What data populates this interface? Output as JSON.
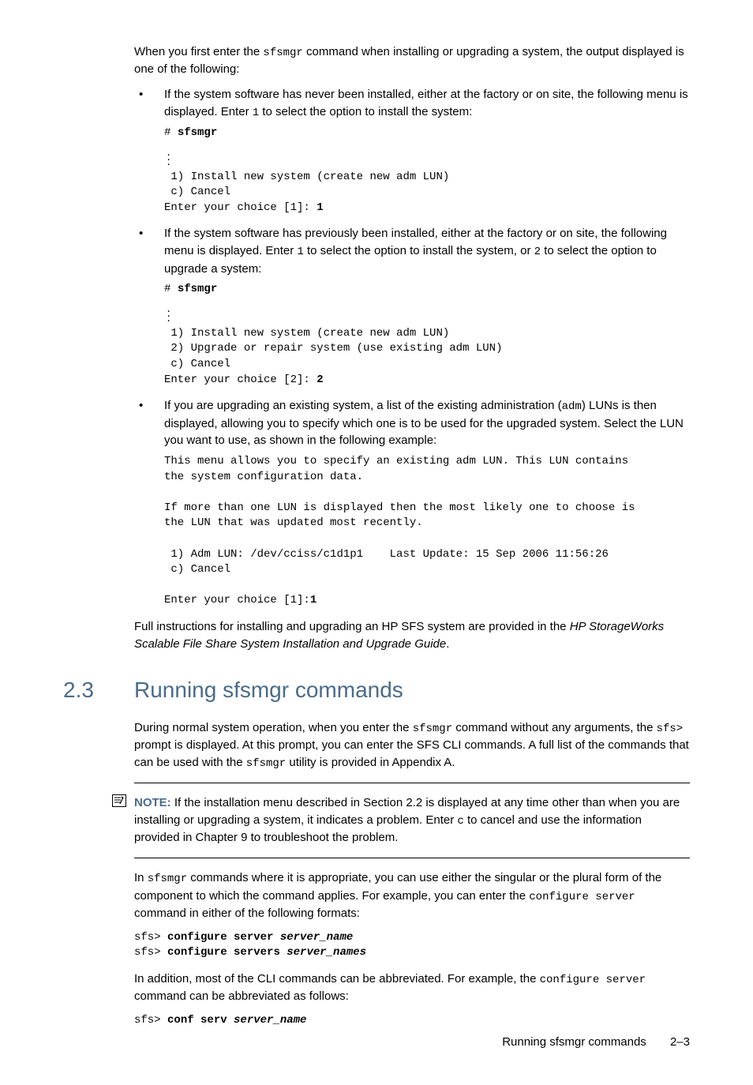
{
  "intro": {
    "p1_a": "When you first enter the ",
    "p1_cmd": "sfsmgr",
    "p1_b": " command when installing or upgrading a system, the output displayed is one of the following:"
  },
  "bullets": [
    {
      "text_a": "If the system software has never been installed, either at the factory or on site, the following menu is displayed. Enter ",
      "text_code": "1",
      "text_b": " to select the option to install the system:",
      "code_prompt": "# ",
      "code_cmd": "sfsmgr",
      "has_vdots": true,
      "code_body": " 1) Install new system (create new adm LUN)\n c) Cancel\nEnter your choice [1]: ",
      "code_input": "1"
    },
    {
      "text_a": "If the system software has previously been installed, either at the factory or on site, the following menu is displayed. Enter ",
      "text_code": "1",
      "text_b": " to select the option to install the system, or ",
      "text_code2": "2",
      "text_c": " to select the option to upgrade a system:",
      "code_prompt": "# ",
      "code_cmd": "sfsmgr",
      "has_vdots": true,
      "code_body": " 1) Install new system (create new adm LUN)\n 2) Upgrade or repair system (use existing adm LUN)\n c) Cancel\nEnter your choice [2]: ",
      "code_input": "2"
    },
    {
      "text_a": "If you are upgrading an existing system, a list of the existing administration (",
      "text_code": "adm",
      "text_b": ") LUNs is then displayed, allowing you to specify which one is to be used for the upgraded system. Select the LUN you want to use, as shown in the following example:",
      "code_body": "This menu allows you to specify an existing adm LUN. This LUN contains\nthe system configuration data.\n\nIf more than one LUN is displayed then the most likely one to choose is\nthe LUN that was updated most recently.\n\n 1) Adm LUN: /dev/cciss/c1d1p1    Last Update: 15 Sep 2006 11:56:26\n c) Cancel\n\nEnter your choice [1]:",
      "code_input": "1"
    }
  ],
  "post_bullets": {
    "a": "Full instructions for installing and upgrading an HP SFS system are provided in the ",
    "i": "HP StorageWorks Scalable File Share System Installation and Upgrade Guide",
    "b": "."
  },
  "section": {
    "num": "2.3",
    "title": "Running sfsmgr commands"
  },
  "running": {
    "p1_a": "During normal system operation, when you enter the ",
    "p1_c1": "sfsmgr",
    "p1_b": " command without any arguments, the ",
    "p1_c2": "sfs>",
    "p1_c": " prompt is displayed. At this prompt, you can enter the SFS CLI commands. A full list of the commands that can be used with the ",
    "p1_c3": "sfsmgr",
    "p1_d": " utility is provided in Appendix A."
  },
  "note": {
    "label": "NOTE:",
    "a": " If the installation menu described in Section 2.2 is displayed at any time other than when you are installing or upgrading a system, it indicates a problem. Enter ",
    "code": "c",
    "b": " to cancel and use the information provided in Chapter 9 to troubleshoot the problem."
  },
  "para2": {
    "a": "In ",
    "c1": "sfsmgr",
    "b": " commands where it is appropriate, you can use either the singular or the plural form of the component to which the command applies. For example, you can enter the ",
    "c2": "configure server",
    "c": " command in either of the following formats:"
  },
  "code2": {
    "l1_prompt": "sfs> ",
    "l1_bold": "configure server ",
    "l1_bi": "server_name",
    "l2_prompt": "sfs> ",
    "l2_bold": "configure servers ",
    "l2_bi": "server_names"
  },
  "para3": {
    "a": "In addition, most of the CLI commands can be abbreviated. For example, the ",
    "c1": "configure server",
    "b": " command can be abbreviated as follows:"
  },
  "code3": {
    "prompt": "sfs> ",
    "bold": "conf serv ",
    "bi": "server_name"
  },
  "footer": {
    "title": "Running sfsmgr commands",
    "page": "2–3"
  }
}
